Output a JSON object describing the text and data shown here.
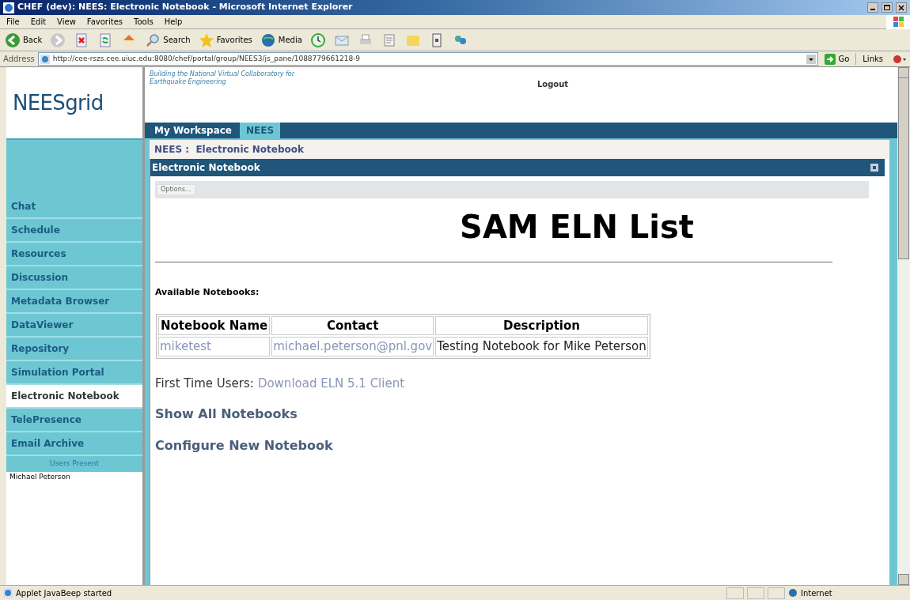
{
  "window": {
    "title": "CHEF (dev): NEES: Electronic Notebook - Microsoft Internet Explorer"
  },
  "menu": [
    "File",
    "Edit",
    "View",
    "Favorites",
    "Tools",
    "Help"
  ],
  "toolbar": [
    {
      "kind": "back",
      "label": "Back"
    },
    {
      "kind": "forward"
    },
    {
      "kind": "stop"
    },
    {
      "kind": "refresh"
    },
    {
      "kind": "home"
    },
    {
      "kind": "search",
      "label": "Search"
    },
    {
      "kind": "favorites",
      "label": "Favorites"
    },
    {
      "kind": "media",
      "label": "Media"
    },
    {
      "kind": "history"
    },
    {
      "kind": "mail"
    },
    {
      "kind": "print"
    },
    {
      "kind": "edit"
    },
    {
      "kind": "folder"
    },
    {
      "kind": "page"
    },
    {
      "kind": "messenger"
    }
  ],
  "address": {
    "label": "Address",
    "value": "http://cee-rszs.cee.uiuc.edu:8080/chef/portal/group/NEES3/js_pane/1088779661218-9",
    "go": "Go",
    "links": "Links"
  },
  "portal": {
    "logo": {
      "main": "NEES",
      "sub": "grid"
    },
    "tagline": "Building the National Virtual Collaboratory for Earthquake Engineering",
    "logout": "Logout",
    "tabs": [
      {
        "label": "My Workspace",
        "selected": false
      },
      {
        "label": "NEES",
        "selected": true
      }
    ],
    "breadcrumb": "NEES :  Electronic Notebook",
    "sidebar": [
      {
        "label": "Chat",
        "selected": false
      },
      {
        "label": "Schedule",
        "selected": false
      },
      {
        "label": "Resources",
        "selected": false
      },
      {
        "label": "Discussion",
        "selected": false
      },
      {
        "label": "Metadata Browser",
        "selected": false
      },
      {
        "label": "DataViewer",
        "selected": false
      },
      {
        "label": "Repository",
        "selected": false
      },
      {
        "label": "Simulation Portal",
        "selected": false
      },
      {
        "label": "Electronic Notebook",
        "selected": true
      },
      {
        "label": "TelePresence",
        "selected": false
      },
      {
        "label": "Email Archive",
        "selected": false
      }
    ],
    "users_present": {
      "heading": "Users Present",
      "users": [
        "Michael Peterson"
      ]
    },
    "panel": {
      "title": "Electronic Notebook",
      "options": "Options...",
      "heading": "SAM ELN List",
      "available": "Available Notebooks:",
      "table": {
        "columns": [
          "Notebook Name",
          "Contact",
          "Description"
        ],
        "rows": [
          [
            "miketest",
            "michael.peterson@pnl.gov",
            "Testing Notebook for Mike Peterson"
          ]
        ]
      },
      "first_time": {
        "label": "First Time Users:",
        "link": "Download ELN 5.1 Client"
      },
      "links": [
        "Show All Notebooks",
        "Configure New Notebook"
      ]
    }
  },
  "status_bar": {
    "text": "Applet JavaBeep started",
    "zone": "Internet"
  }
}
